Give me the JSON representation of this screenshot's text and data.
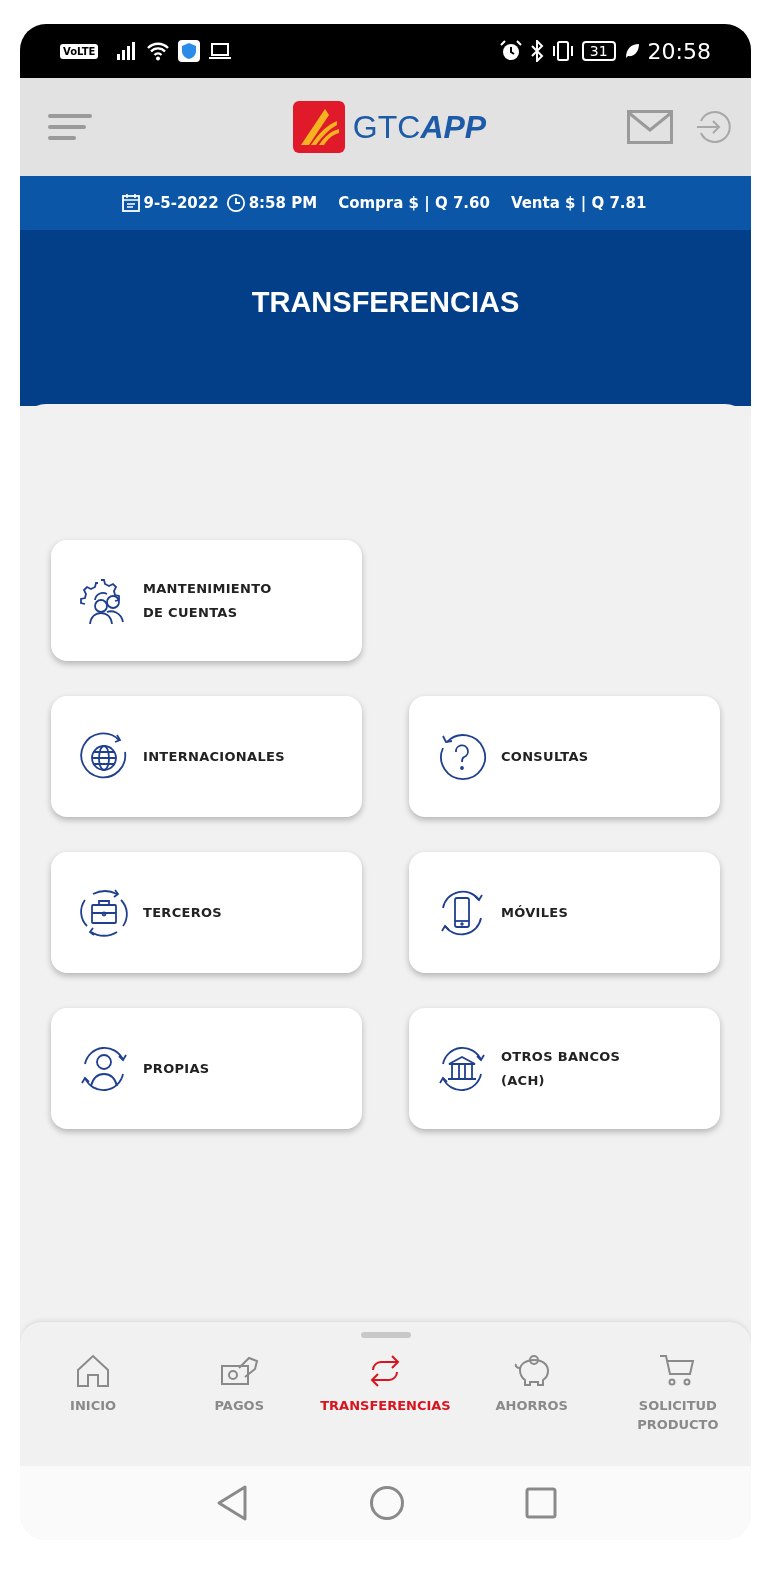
{
  "status_bar": {
    "network_label": "VoLTE",
    "battery": "31",
    "time": "20:58"
  },
  "header": {
    "logo_text_light": "GTC",
    "logo_text_bold": "APP"
  },
  "rate_bar": {
    "date": "9-5-2022",
    "time": "8:58 PM",
    "buy": "Compra $ | Q 7.60",
    "sell": "Venta $ | Q 7.81"
  },
  "page_title": "TRANSFERENCIAS",
  "tile_rows": [
    [
      {
        "kind": "accounts",
        "lines": [
          "MANTENIMIENTO",
          "DE CUENTAS"
        ]
      }
    ],
    [
      {
        "kind": "globe",
        "lines": [
          "INTERNACIONALES"
        ]
      },
      {
        "kind": "question",
        "lines": [
          "CONSULTAS"
        ]
      }
    ],
    [
      {
        "kind": "briefcase",
        "lines": [
          "TERCEROS"
        ]
      },
      {
        "kind": "phone",
        "lines": [
          "MÓVILES"
        ]
      }
    ],
    [
      {
        "kind": "person",
        "lines": [
          "PROPIAS"
        ]
      },
      {
        "kind": "bank",
        "lines": [
          "OTROS BANCOS",
          "(ACH)"
        ]
      }
    ]
  ],
  "bottom_nav": [
    {
      "kind": "home",
      "lines": [
        "INICIO"
      ],
      "selected": false
    },
    {
      "kind": "money",
      "lines": [
        "PAGOS"
      ],
      "selected": false
    },
    {
      "kind": "transfer",
      "lines": [
        "TRANSFERENCIAS"
      ],
      "selected": true
    },
    {
      "kind": "piggy",
      "lines": [
        "AHORROS"
      ],
      "selected": false
    },
    {
      "kind": "cart",
      "lines": [
        "SOLICITUD",
        "PRODUCTO"
      ],
      "selected": false
    }
  ]
}
